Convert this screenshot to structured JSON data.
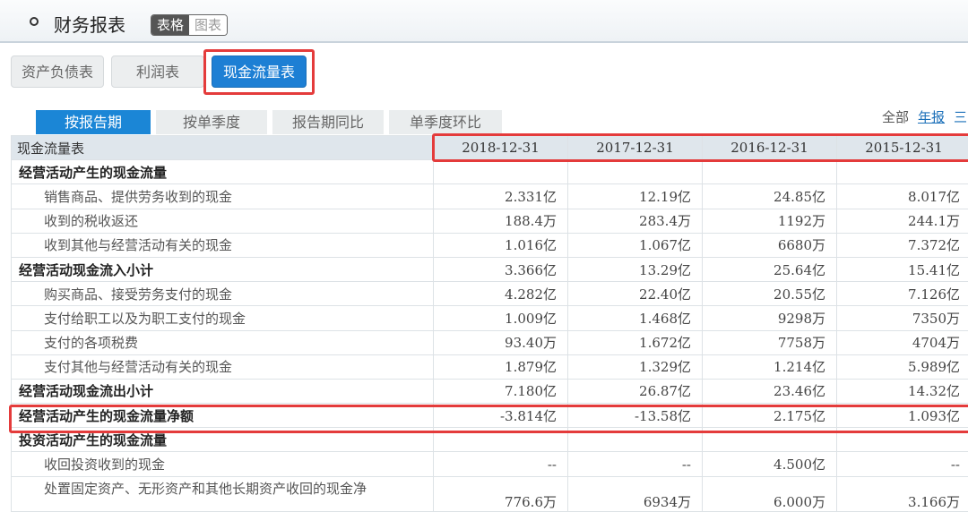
{
  "header": {
    "title": "财务报表",
    "view_table": "表格",
    "view_chart": "图表"
  },
  "statement_tabs": [
    "资产负债表",
    "利润表",
    "现金流量表"
  ],
  "period_tabs": [
    "按报告期",
    "按单季度",
    "报告期同比",
    "单季度环比"
  ],
  "range": {
    "all": "全部",
    "annual": "年报",
    "more": "三"
  },
  "table": {
    "corner": "现金流量表",
    "columns": [
      "2018-12-31",
      "2017-12-31",
      "2016-12-31",
      "2015-12-31"
    ],
    "rows": [
      {
        "label": "经营活动产生的现金流量",
        "values": [
          "",
          "",
          "",
          ""
        ]
      },
      {
        "label": "销售商品、提供劳务收到的现金",
        "values": [
          "2.331亿",
          "12.19亿",
          "24.85亿",
          "8.017亿"
        ]
      },
      {
        "label": "收到的税收返还",
        "values": [
          "188.4万",
          "283.4万",
          "1192万",
          "244.1万"
        ]
      },
      {
        "label": "收到其他与经营活动有关的现金",
        "values": [
          "1.016亿",
          "1.067亿",
          "6680万",
          "7.372亿"
        ]
      },
      {
        "label": "经营活动现金流入小计",
        "values": [
          "3.366亿",
          "13.29亿",
          "25.64亿",
          "15.41亿"
        ]
      },
      {
        "label": "购买商品、接受劳务支付的现金",
        "values": [
          "4.282亿",
          "22.40亿",
          "20.55亿",
          "7.126亿"
        ]
      },
      {
        "label": "支付给职工以及为职工支付的现金",
        "values": [
          "1.009亿",
          "1.468亿",
          "9298万",
          "7350万"
        ]
      },
      {
        "label": "支付的各项税费",
        "values": [
          "93.40万",
          "1.672亿",
          "7758万",
          "4704万"
        ]
      },
      {
        "label": "支付其他与经营活动有关的现金",
        "values": [
          "1.879亿",
          "1.329亿",
          "1.214亿",
          "5.989亿"
        ]
      },
      {
        "label": "经营活动现金流出小计",
        "values": [
          "7.180亿",
          "26.87亿",
          "23.46亿",
          "14.32亿"
        ]
      },
      {
        "label": "经营活动产生的现金流量净额",
        "values": [
          "-3.814亿",
          "-13.58亿",
          "2.175亿",
          "1.093亿"
        ]
      },
      {
        "label": "投资活动产生的现金流量",
        "values": [
          "",
          "",
          "",
          ""
        ]
      },
      {
        "label": "收回投资收到的现金",
        "values": [
          "--",
          "--",
          "4.500亿",
          "--"
        ]
      },
      {
        "label": "处置固定资产、无形资产和其他长期资产收回的现金净",
        "values": [
          "776.6万",
          "6934万",
          "6.000万",
          "3.166万"
        ]
      }
    ]
  }
}
